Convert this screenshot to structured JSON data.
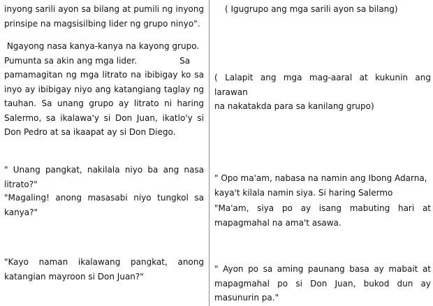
{
  "left_column": {
    "intro": [
      "inyong sarili ayon sa bilang at pumili ng inyong",
      "prinsipe na magsisilbing lider ng grupo ninyo\"."
    ],
    "para1": [
      " Ngayong nasa kanya-kanya na kayong grupo.",
      "Pumunta sa akin ang mga lider.                Sa",
      "pamamagitan ng mga litrato na ibibigay ko sa",
      "inyo ay ibibigay niyo ang katangiang taglay ng",
      "tauhan. Sa unang grupo ay litrato ni haring",
      "Salermo, sa ikalawa'y si Don Juan, ikatlo'y si",
      "Don Pedro at sa ikaapat ay si Don Diego."
    ],
    "para2a": [
      "\" Unang pangkat, nakilala niyo ba ang nasa",
      "litrato?\""
    ],
    "para2b": [
      "\"Magaling! anong masasabi niyo tungkol sa",
      "kanya?\""
    ],
    "para3": [
      "\"Kayo naman ikalawang pangkat, anong",
      "katangian mayroon si Don Juan?\""
    ]
  },
  "right_column": {
    "note1": "( Igugrupo ang mga sarili ayon sa bilang)",
    "note2": [
      "( Lalapit ang mga mag-aaral at kukunin ang larawan",
      "na nakatakda para sa kanilang grupo)"
    ],
    "resp1a": [
      "\" Opo ma'am, nabasa na namin ang Ibong Adarna,",
      "kaya't kilala namin siya. Si haring Salermo"
    ],
    "resp1b": [
      "\"Ma'am, siya po ay isang mabuting hari at",
      "mapagmahal na ama't asawa."
    ],
    "resp2": [
      "\" Ayon po sa aming paunang basa ay mabait at",
      "mapagmahal po si Don Juan, bukod dun ay",
      "masunurin pa.\""
    ]
  }
}
